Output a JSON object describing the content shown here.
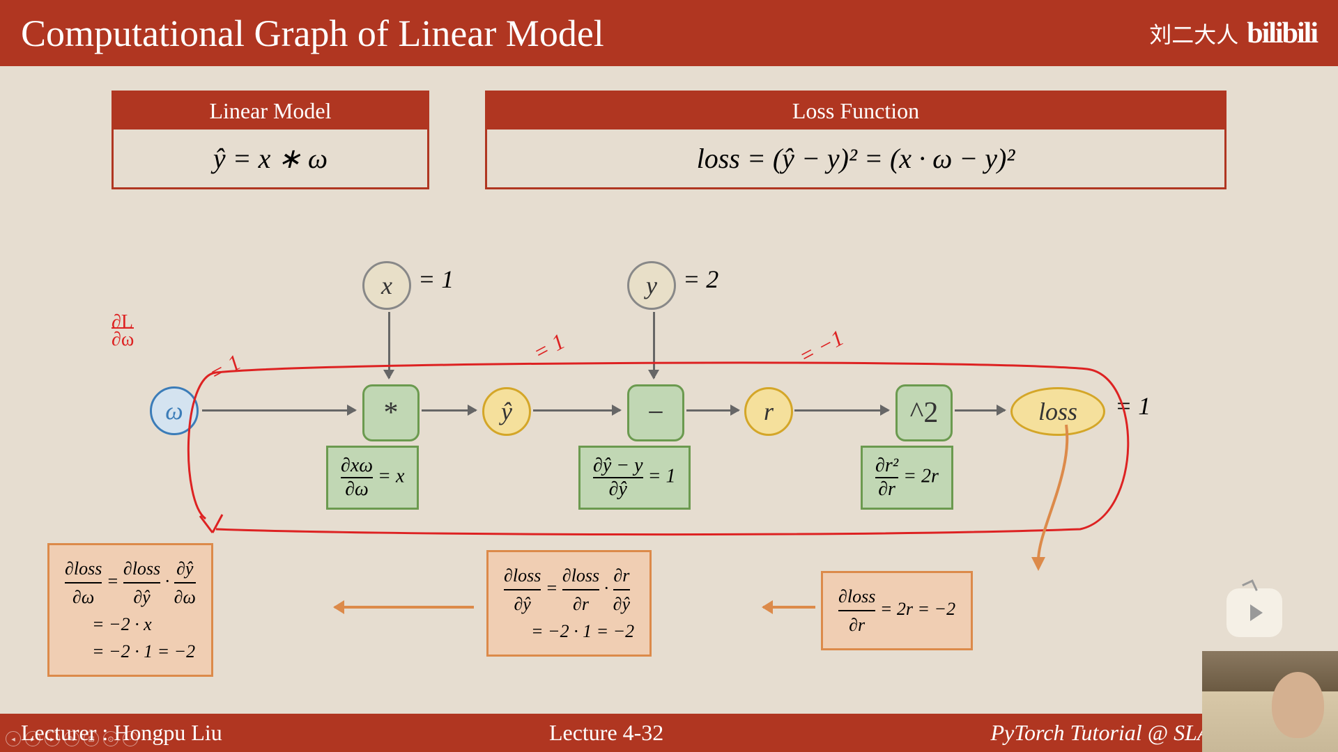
{
  "header": {
    "title": "Computational Graph of Linear Model",
    "author": "刘二大人",
    "logo": "bilibili"
  },
  "equations": {
    "linear": {
      "label": "Linear Model",
      "formula": "ŷ = x ∗ ω"
    },
    "loss": {
      "label": "Loss Function",
      "formula": "loss = (ŷ − y)² = (x · ω − y)²"
    }
  },
  "graph": {
    "nodes": {
      "omega": "ω",
      "x": "x",
      "y": "y",
      "yhat": "ŷ",
      "r": "r",
      "loss": "loss"
    },
    "ops": {
      "mul": "*",
      "sub": "−",
      "sq": "^2"
    },
    "values": {
      "x": "= 1",
      "y": "= 2",
      "yhat": "= 1",
      "r": "= −1",
      "loss": "= 1",
      "omega": "= 1"
    },
    "derivs": {
      "mul": "∂xω / ∂ω = x",
      "sub": "∂ŷ − y / ∂ŷ = 1",
      "sq": "∂r² / ∂r = 2r"
    },
    "red_label": "∂L / ∂ω"
  },
  "calcs": {
    "c1": "∂loss/∂ω = ∂loss/∂ŷ · ∂ŷ/∂ω\n= −2 · x\n= −2 · 1 = −2",
    "c2": "∂loss/∂ŷ = ∂loss/∂r · ∂r/∂ŷ\n= −2 · 1 = −2",
    "c3": "∂loss/∂r = 2r = −2"
  },
  "footer": {
    "lecturer": "Lecturer : Hongpu Liu",
    "lecture": "Lecture 4-32",
    "tutorial": "PyTorch Tutorial @ SLAM Research"
  }
}
